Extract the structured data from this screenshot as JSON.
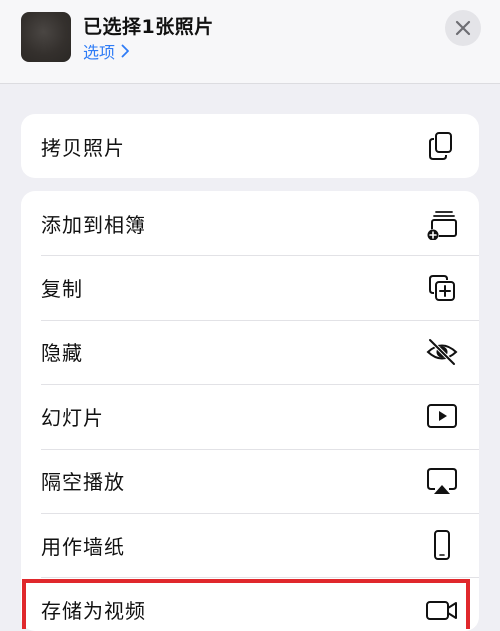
{
  "header": {
    "title": "已选择1张照片",
    "options_label": "选项"
  },
  "actions_top": [
    {
      "label": "拷贝照片",
      "icon": "copy-photo-icon"
    }
  ],
  "actions": [
    {
      "label": "添加到相簿",
      "icon": "add-to-album-icon"
    },
    {
      "label": "复制",
      "icon": "duplicate-icon"
    },
    {
      "label": "隐藏",
      "icon": "eye-slash-icon"
    },
    {
      "label": "幻灯片",
      "icon": "play-icon"
    },
    {
      "label": "隔空播放",
      "icon": "airplay-icon"
    },
    {
      "label": "用作墙纸",
      "icon": "phone-icon"
    },
    {
      "label": "存储为视频",
      "icon": "video-camera-icon"
    }
  ],
  "colors": {
    "accent": "#2f7cf6",
    "highlight_box": "#e0282c",
    "background": "#efeff4"
  }
}
